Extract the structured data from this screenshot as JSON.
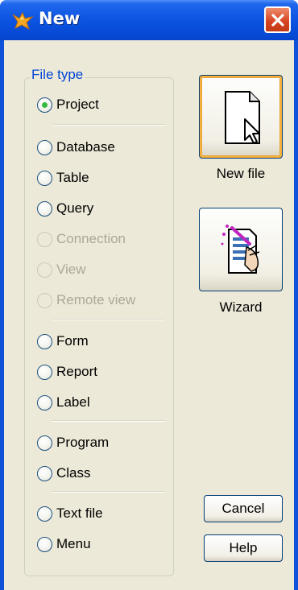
{
  "window": {
    "title": "New"
  },
  "file_type": {
    "label": "File type",
    "selected": "project",
    "options": [
      {
        "id": "project",
        "label": "Project",
        "enabled": true
      },
      {
        "id": "database",
        "label": "Database",
        "enabled": true
      },
      {
        "id": "table",
        "label": "Table",
        "enabled": true
      },
      {
        "id": "query",
        "label": "Query",
        "enabled": true
      },
      {
        "id": "connection",
        "label": "Connection",
        "enabled": false
      },
      {
        "id": "view",
        "label": "View",
        "enabled": false
      },
      {
        "id": "remote_view",
        "label": "Remote view",
        "enabled": false
      },
      {
        "id": "form",
        "label": "Form",
        "enabled": true
      },
      {
        "id": "report",
        "label": "Report",
        "enabled": true
      },
      {
        "id": "label",
        "label": "Label",
        "enabled": true
      },
      {
        "id": "program",
        "label": "Program",
        "enabled": true
      },
      {
        "id": "class",
        "label": "Class",
        "enabled": true
      },
      {
        "id": "text_file",
        "label": "Text file",
        "enabled": true
      },
      {
        "id": "menu",
        "label": "Menu",
        "enabled": true
      }
    ]
  },
  "buttons": {
    "new_file": "New file",
    "wizard": "Wizard",
    "cancel": "Cancel",
    "help": "Help"
  },
  "colors": {
    "title_bar": "#0a52e0",
    "dialog_bg": "#ece9d8",
    "group_label": "#0046d5",
    "selected_dot": "#36b93c",
    "focus_ring": "#f7b23d"
  }
}
